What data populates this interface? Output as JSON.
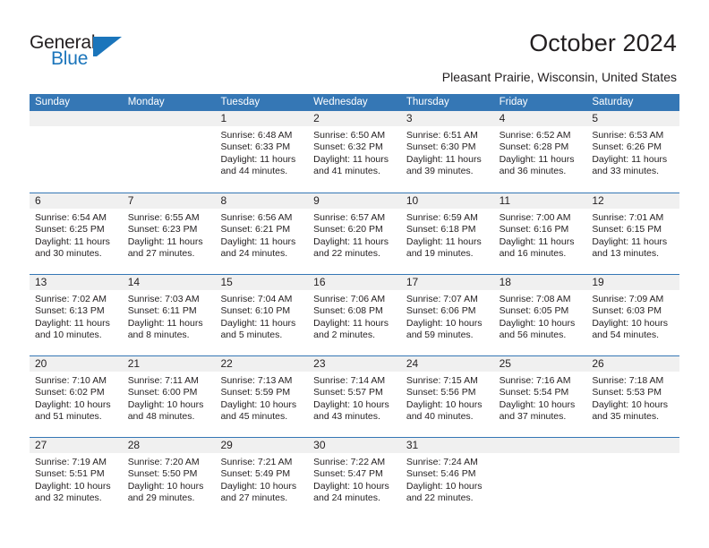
{
  "brand": {
    "name_part1": "General",
    "name_part2": "Blue",
    "accent_color": "#1b75bb",
    "logo_icon": "flag-triangle-icon"
  },
  "header": {
    "title": "October 2024",
    "subtitle": "Pleasant Prairie, Wisconsin, United States"
  },
  "theme": {
    "header_blue": "#3577b5",
    "day_band_gray": "#f0f0f0",
    "text_color": "#231f20"
  },
  "calendar": {
    "weekdays": [
      "Sunday",
      "Monday",
      "Tuesday",
      "Wednesday",
      "Thursday",
      "Friday",
      "Saturday"
    ],
    "weeks": [
      [
        {
          "day": "",
          "sunrise": "",
          "sunset": "",
          "daylight_line1": "",
          "daylight_line2": "",
          "empty": true
        },
        {
          "day": "",
          "sunrise": "",
          "sunset": "",
          "daylight_line1": "",
          "daylight_line2": "",
          "empty": true
        },
        {
          "day": "1",
          "sunrise": "Sunrise: 6:48 AM",
          "sunset": "Sunset: 6:33 PM",
          "daylight_line1": "Daylight: 11 hours",
          "daylight_line2": "and 44 minutes."
        },
        {
          "day": "2",
          "sunrise": "Sunrise: 6:50 AM",
          "sunset": "Sunset: 6:32 PM",
          "daylight_line1": "Daylight: 11 hours",
          "daylight_line2": "and 41 minutes."
        },
        {
          "day": "3",
          "sunrise": "Sunrise: 6:51 AM",
          "sunset": "Sunset: 6:30 PM",
          "daylight_line1": "Daylight: 11 hours",
          "daylight_line2": "and 39 minutes."
        },
        {
          "day": "4",
          "sunrise": "Sunrise: 6:52 AM",
          "sunset": "Sunset: 6:28 PM",
          "daylight_line1": "Daylight: 11 hours",
          "daylight_line2": "and 36 minutes."
        },
        {
          "day": "5",
          "sunrise": "Sunrise: 6:53 AM",
          "sunset": "Sunset: 6:26 PM",
          "daylight_line1": "Daylight: 11 hours",
          "daylight_line2": "and 33 minutes."
        }
      ],
      [
        {
          "day": "6",
          "sunrise": "Sunrise: 6:54 AM",
          "sunset": "Sunset: 6:25 PM",
          "daylight_line1": "Daylight: 11 hours",
          "daylight_line2": "and 30 minutes."
        },
        {
          "day": "7",
          "sunrise": "Sunrise: 6:55 AM",
          "sunset": "Sunset: 6:23 PM",
          "daylight_line1": "Daylight: 11 hours",
          "daylight_line2": "and 27 minutes."
        },
        {
          "day": "8",
          "sunrise": "Sunrise: 6:56 AM",
          "sunset": "Sunset: 6:21 PM",
          "daylight_line1": "Daylight: 11 hours",
          "daylight_line2": "and 24 minutes."
        },
        {
          "day": "9",
          "sunrise": "Sunrise: 6:57 AM",
          "sunset": "Sunset: 6:20 PM",
          "daylight_line1": "Daylight: 11 hours",
          "daylight_line2": "and 22 minutes."
        },
        {
          "day": "10",
          "sunrise": "Sunrise: 6:59 AM",
          "sunset": "Sunset: 6:18 PM",
          "daylight_line1": "Daylight: 11 hours",
          "daylight_line2": "and 19 minutes."
        },
        {
          "day": "11",
          "sunrise": "Sunrise: 7:00 AM",
          "sunset": "Sunset: 6:16 PM",
          "daylight_line1": "Daylight: 11 hours",
          "daylight_line2": "and 16 minutes."
        },
        {
          "day": "12",
          "sunrise": "Sunrise: 7:01 AM",
          "sunset": "Sunset: 6:15 PM",
          "daylight_line1": "Daylight: 11 hours",
          "daylight_line2": "and 13 minutes."
        }
      ],
      [
        {
          "day": "13",
          "sunrise": "Sunrise: 7:02 AM",
          "sunset": "Sunset: 6:13 PM",
          "daylight_line1": "Daylight: 11 hours",
          "daylight_line2": "and 10 minutes."
        },
        {
          "day": "14",
          "sunrise": "Sunrise: 7:03 AM",
          "sunset": "Sunset: 6:11 PM",
          "daylight_line1": "Daylight: 11 hours",
          "daylight_line2": "and 8 minutes."
        },
        {
          "day": "15",
          "sunrise": "Sunrise: 7:04 AM",
          "sunset": "Sunset: 6:10 PM",
          "daylight_line1": "Daylight: 11 hours",
          "daylight_line2": "and 5 minutes."
        },
        {
          "day": "16",
          "sunrise": "Sunrise: 7:06 AM",
          "sunset": "Sunset: 6:08 PM",
          "daylight_line1": "Daylight: 11 hours",
          "daylight_line2": "and 2 minutes."
        },
        {
          "day": "17",
          "sunrise": "Sunrise: 7:07 AM",
          "sunset": "Sunset: 6:06 PM",
          "daylight_line1": "Daylight: 10 hours",
          "daylight_line2": "and 59 minutes."
        },
        {
          "day": "18",
          "sunrise": "Sunrise: 7:08 AM",
          "sunset": "Sunset: 6:05 PM",
          "daylight_line1": "Daylight: 10 hours",
          "daylight_line2": "and 56 minutes."
        },
        {
          "day": "19",
          "sunrise": "Sunrise: 7:09 AM",
          "sunset": "Sunset: 6:03 PM",
          "daylight_line1": "Daylight: 10 hours",
          "daylight_line2": "and 54 minutes."
        }
      ],
      [
        {
          "day": "20",
          "sunrise": "Sunrise: 7:10 AM",
          "sunset": "Sunset: 6:02 PM",
          "daylight_line1": "Daylight: 10 hours",
          "daylight_line2": "and 51 minutes."
        },
        {
          "day": "21",
          "sunrise": "Sunrise: 7:11 AM",
          "sunset": "Sunset: 6:00 PM",
          "daylight_line1": "Daylight: 10 hours",
          "daylight_line2": "and 48 minutes."
        },
        {
          "day": "22",
          "sunrise": "Sunrise: 7:13 AM",
          "sunset": "Sunset: 5:59 PM",
          "daylight_line1": "Daylight: 10 hours",
          "daylight_line2": "and 45 minutes."
        },
        {
          "day": "23",
          "sunrise": "Sunrise: 7:14 AM",
          "sunset": "Sunset: 5:57 PM",
          "daylight_line1": "Daylight: 10 hours",
          "daylight_line2": "and 43 minutes."
        },
        {
          "day": "24",
          "sunrise": "Sunrise: 7:15 AM",
          "sunset": "Sunset: 5:56 PM",
          "daylight_line1": "Daylight: 10 hours",
          "daylight_line2": "and 40 minutes."
        },
        {
          "day": "25",
          "sunrise": "Sunrise: 7:16 AM",
          "sunset": "Sunset: 5:54 PM",
          "daylight_line1": "Daylight: 10 hours",
          "daylight_line2": "and 37 minutes."
        },
        {
          "day": "26",
          "sunrise": "Sunrise: 7:18 AM",
          "sunset": "Sunset: 5:53 PM",
          "daylight_line1": "Daylight: 10 hours",
          "daylight_line2": "and 35 minutes."
        }
      ],
      [
        {
          "day": "27",
          "sunrise": "Sunrise: 7:19 AM",
          "sunset": "Sunset: 5:51 PM",
          "daylight_line1": "Daylight: 10 hours",
          "daylight_line2": "and 32 minutes."
        },
        {
          "day": "28",
          "sunrise": "Sunrise: 7:20 AM",
          "sunset": "Sunset: 5:50 PM",
          "daylight_line1": "Daylight: 10 hours",
          "daylight_line2": "and 29 minutes."
        },
        {
          "day": "29",
          "sunrise": "Sunrise: 7:21 AM",
          "sunset": "Sunset: 5:49 PM",
          "daylight_line1": "Daylight: 10 hours",
          "daylight_line2": "and 27 minutes."
        },
        {
          "day": "30",
          "sunrise": "Sunrise: 7:22 AM",
          "sunset": "Sunset: 5:47 PM",
          "daylight_line1": "Daylight: 10 hours",
          "daylight_line2": "and 24 minutes."
        },
        {
          "day": "31",
          "sunrise": "Sunrise: 7:24 AM",
          "sunset": "Sunset: 5:46 PM",
          "daylight_line1": "Daylight: 10 hours",
          "daylight_line2": "and 22 minutes."
        },
        {
          "day": "",
          "sunrise": "",
          "sunset": "",
          "daylight_line1": "",
          "daylight_line2": "",
          "empty": true
        },
        {
          "day": "",
          "sunrise": "",
          "sunset": "",
          "daylight_line1": "",
          "daylight_line2": "",
          "empty": true
        }
      ]
    ]
  }
}
